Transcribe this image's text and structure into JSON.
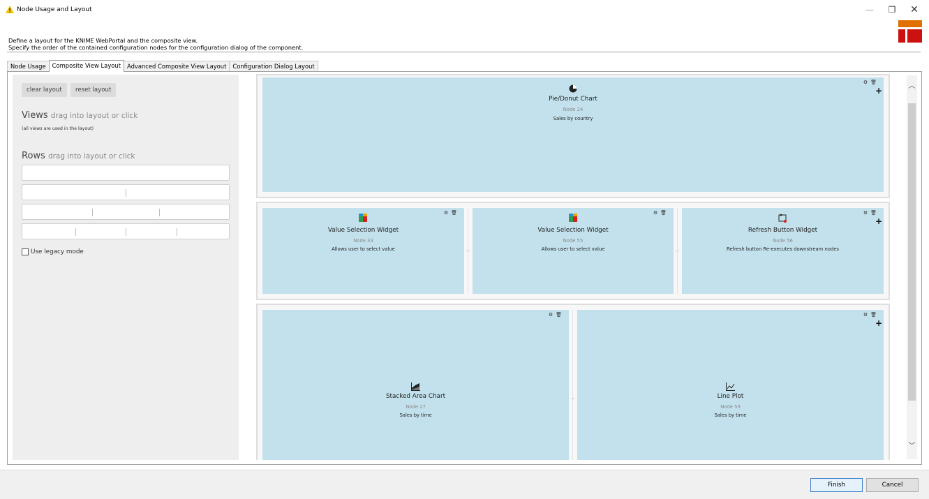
{
  "window": {
    "title": "Node Usage and Layout",
    "minimize": "—",
    "restore": "❐",
    "close": "✕"
  },
  "description": {
    "line1": "Define a layout for the KNIME WebPortal and the composite view.",
    "line2": "Specify the order of the contained configuration nodes for the configuration dialog of the component."
  },
  "tabs": [
    {
      "label": "Node Usage"
    },
    {
      "label": "Composite View Layout",
      "active": true
    },
    {
      "label": "Advanced Composite View Layout"
    },
    {
      "label": "Configuration Dialog Layout"
    }
  ],
  "sidebar": {
    "clear_label": "clear layout",
    "reset_label": "reset layout",
    "views_title": "Views",
    "views_hint": "drag into layout or click",
    "views_note": "(all views are used in the layout)",
    "rows_title": "Rows",
    "rows_hint": "drag into layout or click",
    "legacy_label": "Use legacy mode"
  },
  "layout": {
    "cards": [
      {
        "icon": "pie-chart-icon",
        "title": "Pie/Donut Chart",
        "node": "Node 24",
        "desc": "Sales by country"
      },
      {
        "icon": "value-selection-icon",
        "title": "Value Selection Widget",
        "node": "Node 33",
        "desc": "Allows user to select value"
      },
      {
        "icon": "value-selection-icon",
        "title": "Value Selection Widget",
        "node": "Node 55",
        "desc": "Allows user to select value"
      },
      {
        "icon": "refresh-icon",
        "title": "Refresh Button Widget",
        "node": "Node 56",
        "desc": "Refresh button Re-executes downstream nodes"
      },
      {
        "icon": "stacked-area-icon",
        "title": "Stacked Area Chart",
        "node": "Node 27",
        "desc": "Sales by time"
      },
      {
        "icon": "line-plot-icon",
        "title": "Line Plot",
        "node": "Node 53",
        "desc": "Sales by time"
      }
    ]
  },
  "footer": {
    "finish_label": "Finish",
    "cancel_label": "Cancel"
  },
  "colors": {
    "card_bg": "#c2e1ec",
    "accent": "#e07000",
    "logo_red": "#cc1111"
  }
}
